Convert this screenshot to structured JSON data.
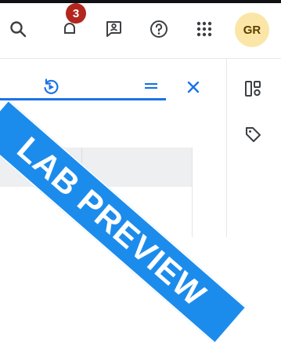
{
  "topbar": {
    "icons": {
      "search": "search-icon",
      "notifications": "bell-icon",
      "feedback": "feedback-icon",
      "help": "help-icon",
      "apps": "apps-grid-icon"
    },
    "notification_count": "3",
    "avatar_initials": "GR"
  },
  "panel_toolbar": {
    "icons": {
      "refresh": "refresh-icon",
      "filter": "filter-lines-icon",
      "close": "close-icon"
    }
  },
  "right_rail": {
    "icons": {
      "layout": "layout-icon",
      "tag": "tag-icon"
    }
  },
  "watermark": {
    "text": "LAB PREVIEW"
  },
  "colors": {
    "accent": "#1a73e8",
    "banner": "#1c8cec",
    "badge": "#b3261e",
    "avatar_bg": "#fbe6a7",
    "icon": "#3c4043"
  }
}
